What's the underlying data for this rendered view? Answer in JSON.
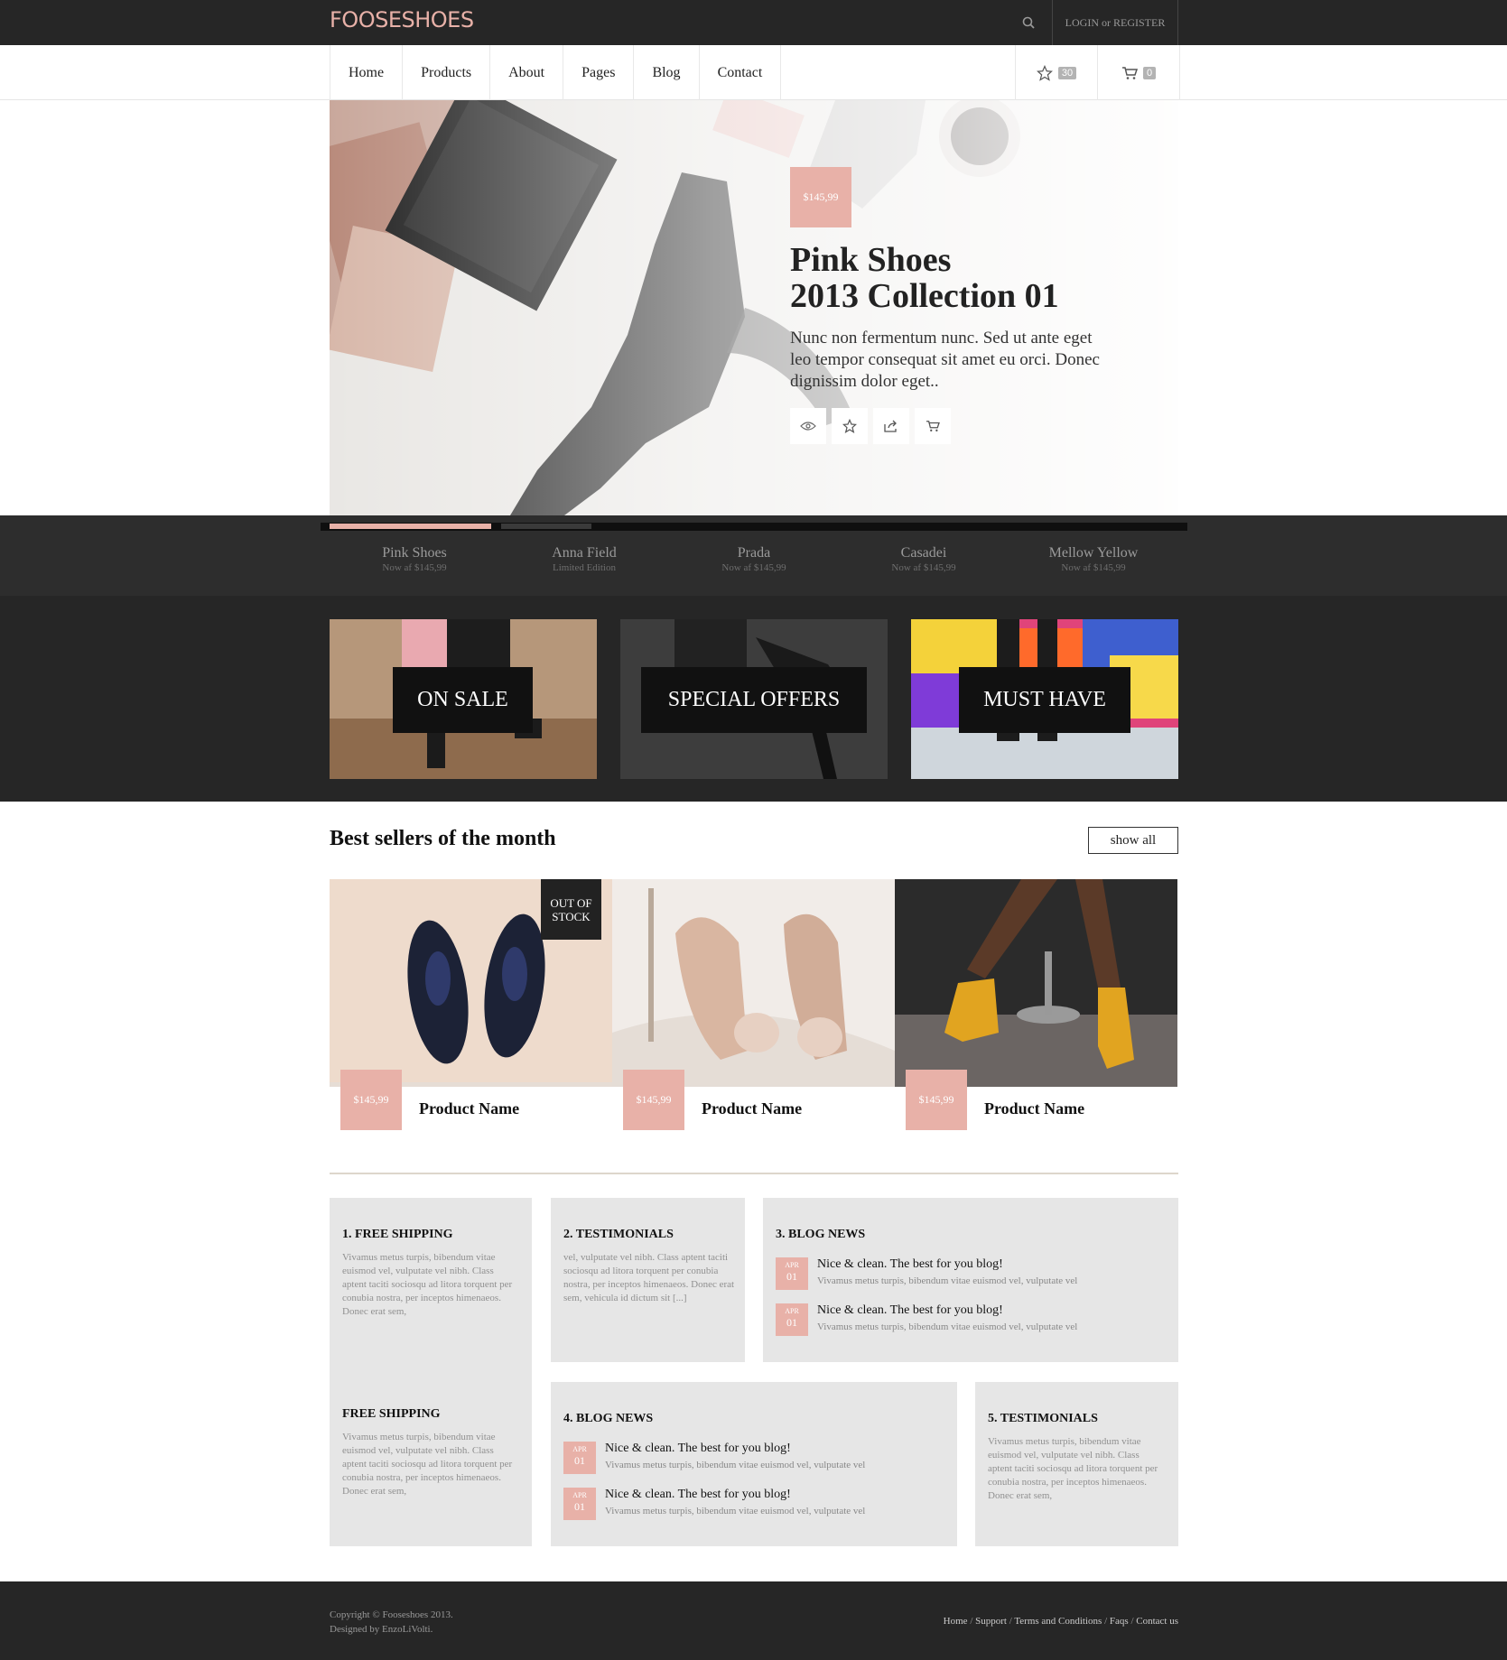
{
  "brand": {
    "logo": "FOOSESHOES",
    "accent": "#e8b1a8",
    "dark": "#262626"
  },
  "topbar": {
    "login": "LOGIN or REGISTER"
  },
  "nav": {
    "items": [
      "Home",
      "Products",
      "About",
      "Pages",
      "Blog",
      "Contact"
    ],
    "wishlist_count": "30",
    "cart_count": "0"
  },
  "hero": {
    "price": "$145,99",
    "title_line1": "Pink Shoes",
    "title_line2": "2013 Collection 01",
    "description": "Nunc non fermentum nunc. Sed ut ante eget leo tempor consequat sit amet eu orci. Donec dignissim dolor eget.."
  },
  "slider": {
    "tabs": [
      {
        "title": "Pink Shoes",
        "sub": "Now af $145,99"
      },
      {
        "title": "Anna Field",
        "sub": "Limited Edition"
      },
      {
        "title": "Prada",
        "sub": "Now af $145,99"
      },
      {
        "title": "Casadei",
        "sub": "Now af $145,99"
      },
      {
        "title": "Mellow Yellow",
        "sub": "Now af $145,99"
      }
    ]
  },
  "categories": [
    "ON SALE",
    "SPECIAL OFFERS",
    "MUST HAVE"
  ],
  "best_sellers": {
    "title": "Best sellers of the month",
    "show_all": "show all",
    "out_of_stock": "OUT OF STOCK",
    "products": [
      {
        "price": "$145,99",
        "name": "Product Name"
      },
      {
        "price": "$145,99",
        "name": "Product Name"
      },
      {
        "price": "$145,99",
        "name": "Product Name"
      }
    ]
  },
  "boxes": {
    "b1": {
      "title": "1. FREE SHIPPING",
      "text": "Vivamus metus turpis, bibendum vitae euismod vel, vulputate vel nibh. Class aptent taciti sociosqu ad litora torquent per conubia nostra, per inceptos himenaeos. Donec erat sem,"
    },
    "b2": {
      "title": "2. TESTIMONIALS",
      "text": "vel, vulputate vel nibh. Class aptent taciti sociosqu ad litora torquent per conubia nostra, per inceptos himenaeos. Donec erat sem, vehicula id dictum sit [...]"
    },
    "b3": {
      "title": "3. BLOG NEWS"
    },
    "b4": {
      "title": "FREE SHIPPING",
      "text": "Vivamus metus turpis, bibendum vitae euismod vel, vulputate vel nibh. Class aptent taciti sociosqu ad litora torquent per conubia nostra, per inceptos himenaeos. Donec erat sem,"
    },
    "b5": {
      "title": "4. BLOG NEWS"
    },
    "b6": {
      "title": "5. TESTIMONIALS",
      "text": "Vivamus metus turpis, bibendum vitae euismod vel, vulputate vel nibh. Class aptent taciti sociosqu ad litora torquent per conubia nostra, per inceptos himenaeos. Donec erat sem,"
    }
  },
  "news": {
    "month": "APR",
    "day": "01",
    "title": "Nice & clean. The best for you blog!",
    "snippet": "Vivamus metus turpis, bibendum vitae euismod vel, vulputate vel"
  },
  "footer": {
    "copyright": "Copyright © Fooseshoes 2013.",
    "designed": "Designed by EnzoLiVolti.",
    "links": [
      "Home",
      "Support",
      "Terms and Conditions",
      "Faqs",
      "Contact us"
    ]
  }
}
